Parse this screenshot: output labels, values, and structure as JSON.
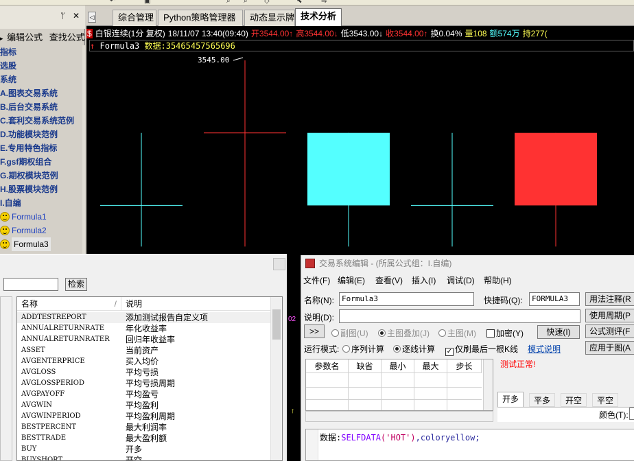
{
  "colors": {
    "chart_bg": "#000000",
    "up": "#ff3232",
    "down": "#54ffff",
    "quote_yellow": "#ffff54",
    "quote_white": "#ffffff",
    "quote_green": "#54ff54",
    "tree_blue": "#1a3a8c",
    "status_red": "#ff0000",
    "code_fn": "#8000ff"
  },
  "toolbar": {
    "glyphs": [
      "↶",
      "▣",
      "⌕",
      "⌕",
      "◇",
      "⬉",
      "⇋"
    ]
  },
  "left_panel": {
    "pin_glyph": "ᛘ",
    "close_glyph": "✕",
    "menu": [
      "编辑公式",
      "查找公式"
    ],
    "tree": [
      {
        "label": "指标"
      },
      {
        "label": "选股"
      },
      {
        "label": "系统"
      },
      {
        "label": "A.图表交易系统"
      },
      {
        "label": "B.后台交易系统"
      },
      {
        "label": "C.套利交易系统范例"
      },
      {
        "label": "D.功能模块范例"
      },
      {
        "label": "E.专用特色指标"
      },
      {
        "label": "F.gsf期权组合"
      },
      {
        "label": "G.期权模块范例"
      },
      {
        "label": "H.股票模块范例"
      },
      {
        "label": "I.自编"
      }
    ],
    "formulas": [
      "Formula1",
      "Formula2",
      "Formula3"
    ]
  },
  "tabs": {
    "arrow": "◁",
    "items": [
      "综合管理",
      "Python策略管理器",
      "动态显示牌",
      "技术分析"
    ],
    "active_index": 3
  },
  "quote": {
    "symbol_mark": "$",
    "name": "白银连续(1分 复权)",
    "datetime": "18/11/07 13:40(09:40)",
    "open": "开3544.00↑",
    "high": "高3544.00↓",
    "low": "低3543.00↓",
    "close": "收3544.00↑",
    "change": "换0.04%",
    "volume": "量108",
    "amount": "额574万",
    "hold": "持277("
  },
  "formula_bar": {
    "arrow": "↑",
    "name": "Formula3",
    "data_label": "数据:",
    "data_value": "35465457565696"
  },
  "chart_data": {
    "type": "candlestick",
    "price_label": "3545.00",
    "candles": [
      {
        "open": 3543,
        "high": 3544,
        "low": 3543,
        "close": 3543,
        "dir": "down"
      },
      {
        "open": 3544,
        "high": 3545,
        "low": 3543,
        "close": 3544,
        "dir": "up"
      },
      {
        "open": 3544,
        "high": 3544,
        "low": 3543,
        "close": 3543,
        "dir": "down"
      },
      {
        "open": 3543,
        "high": 3544,
        "low": 3543,
        "close": 3543,
        "dir": "down"
      },
      {
        "open": 3544,
        "high": 3544,
        "low": 3543,
        "close": 3543,
        "dir": "up"
      }
    ],
    "ylim": [
      3542.9,
      3545.0
    ]
  },
  "list_panel": {
    "search_placeholder": "",
    "search_button": "检索",
    "header_name": "名称",
    "header_desc": "说明",
    "sort_glyph": "/",
    "rows": [
      {
        "name": "ADDTESTREPORT",
        "desc": "添加测试报告自定义项"
      },
      {
        "name": "ANNUALRETURNRATE",
        "desc": "年化收益率"
      },
      {
        "name": "ANNUALRETURNRATER",
        "desc": "回归年收益率"
      },
      {
        "name": "ASSET",
        "desc": "当前资产"
      },
      {
        "name": "AVGENTERPRICE",
        "desc": "买入均价"
      },
      {
        "name": "AVGLOSS",
        "desc": "平均亏损"
      },
      {
        "name": "AVGLOSSPERIOD",
        "desc": "平均亏损周期"
      },
      {
        "name": "AVGPAYOFF",
        "desc": "平均盈亏"
      },
      {
        "name": "AVGWIN",
        "desc": "平均盈利"
      },
      {
        "name": "AVGWINPERIOD",
        "desc": "平均盈利周期"
      },
      {
        "name": "BESTPERCENT",
        "desc": "最大利润率"
      },
      {
        "name": "BESTTRADE",
        "desc": "最大盈利额"
      },
      {
        "name": "BUY",
        "desc": "开多"
      },
      {
        "name": "BUYSHORT",
        "desc": "开空"
      }
    ]
  },
  "mid_strip": {
    "label_top": "02",
    "label_bottom": "↑"
  },
  "dialog": {
    "title": "交易系统编辑 - (所属公式组：I.自编)",
    "menu": [
      "文件(F)",
      "编辑(E)",
      "查看(V)",
      "插入(I)",
      "调试(D)",
      "帮助(H)"
    ],
    "name_label": "名称(N):",
    "name_value": "Formula3",
    "shortcut_label": "快捷码(Q):",
    "shortcut_value": "FORMULA3",
    "desc_label": "说明(D):",
    "desc_value": "",
    "expand_button": ">>",
    "radio_sub": "副图(U)",
    "radio_main_overlay": "主图叠加(J)",
    "radio_main": "主图(M)",
    "encrypt_label": "加密(Y)",
    "quick_button": "快速(I)",
    "run_mode_label": "运行模式:",
    "run_serial": "序列计算",
    "run_tick": "逐线计算",
    "last_kline": "仅刷最后一根K线",
    "mode_help": "模式说明",
    "side_buttons": [
      "用法注释(R",
      "使用周期(P",
      "公式测评(F",
      "应用于图(A"
    ],
    "param_headers": [
      "参数名",
      "缺省",
      "最小",
      "最大",
      "步长"
    ],
    "status": "测试正常!",
    "sub_tabs": [
      "开多",
      "平多",
      "开空",
      "平空"
    ],
    "color_label": "颜色(T):",
    "code": {
      "prefix": "数据:",
      "fn": "SELFDATA",
      "arg": "('HOT')",
      "suffix": ",coloryellow;"
    }
  }
}
